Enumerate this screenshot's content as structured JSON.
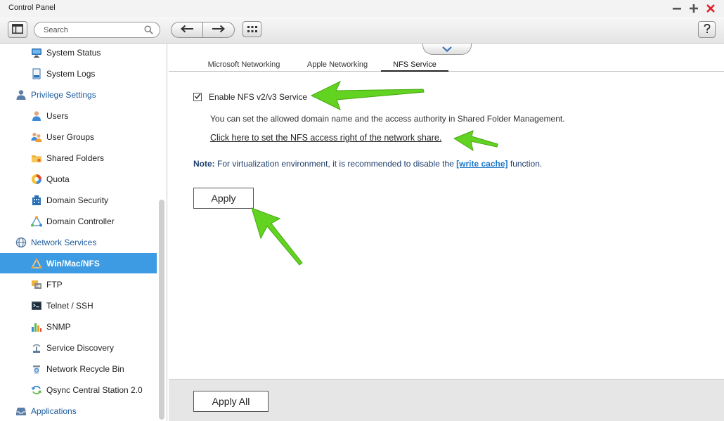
{
  "window": {
    "title": "Control Panel"
  },
  "toolbar": {
    "search_placeholder": "Search"
  },
  "sidebar": {
    "items": [
      {
        "label": "System Status",
        "type": "sub",
        "icon": "monitor-icon"
      },
      {
        "label": "System Logs",
        "type": "sub",
        "icon": "log-icon"
      },
      {
        "label": "Privilege Settings",
        "type": "category",
        "icon": "person-icon"
      },
      {
        "label": "Users",
        "type": "sub",
        "icon": "user-icon"
      },
      {
        "label": "User Groups",
        "type": "sub",
        "icon": "user-group-icon"
      },
      {
        "label": "Shared Folders",
        "type": "sub",
        "icon": "folder-icon"
      },
      {
        "label": "Quota",
        "type": "sub",
        "icon": "pie-icon"
      },
      {
        "label": "Domain Security",
        "type": "sub",
        "icon": "building-icon"
      },
      {
        "label": "Domain Controller",
        "type": "sub",
        "icon": "triangle-network-icon"
      },
      {
        "label": "Network Services",
        "type": "category",
        "icon": "globe-icon"
      },
      {
        "label": "Win/Mac/NFS",
        "type": "sub",
        "icon": "winmacnfs-icon",
        "active": true
      },
      {
        "label": "FTP",
        "type": "sub",
        "icon": "ftp-icon"
      },
      {
        "label": "Telnet / SSH",
        "type": "sub",
        "icon": "terminal-icon"
      },
      {
        "label": "SNMP",
        "type": "sub",
        "icon": "bar-chart-icon"
      },
      {
        "label": "Service Discovery",
        "type": "sub",
        "icon": "discovery-icon"
      },
      {
        "label": "Network Recycle Bin",
        "type": "sub",
        "icon": "recycle-bin-icon"
      },
      {
        "label": "Qsync Central Station 2.0",
        "type": "sub",
        "icon": "sync-icon"
      },
      {
        "label": "Applications",
        "type": "category",
        "icon": "tray-icon"
      }
    ]
  },
  "tabs": [
    {
      "label": "Microsoft Networking"
    },
    {
      "label": "Apple Networking"
    },
    {
      "label": "NFS Service",
      "active": true
    }
  ],
  "nfs": {
    "enable_label": "Enable NFS v2/v3 Service",
    "enabled": true,
    "description": "You can set the allowed domain name and the access authority in Shared Folder Management.",
    "link_text": "Click here to set the NFS access right of the network share.",
    "note_label": "Note:",
    "note_text_before": " For virtualization environment, it is recommended to disable the ",
    "note_link": "[write cache]",
    "note_text_after": " function.",
    "apply_label": "Apply"
  },
  "footer": {
    "apply_all_label": "Apply All"
  },
  "colors": {
    "accent": "#3d9be3",
    "category_text": "#1a5a9c",
    "arrow": "#63d321",
    "close": "#e0202a"
  }
}
